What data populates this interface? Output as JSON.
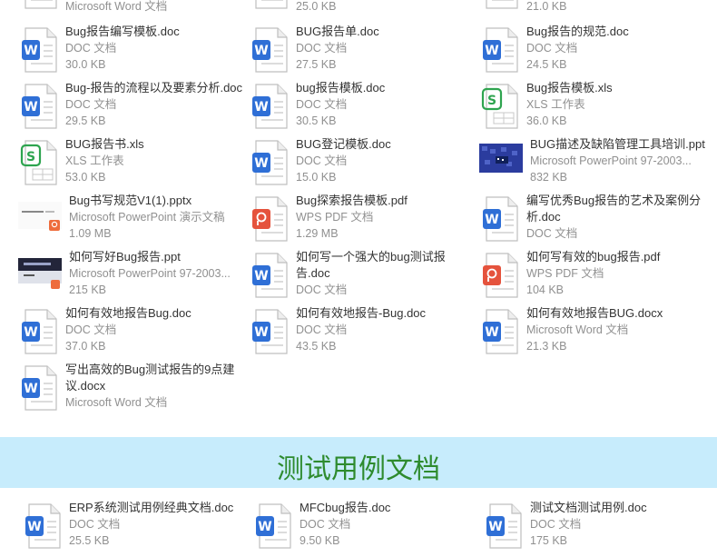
{
  "top_partial": {
    "c1_type": "Microsoft Word 文档",
    "c2_size": "25.0 KB",
    "c3_size": "21.0 KB"
  },
  "rows": [
    [
      {
        "name": "Bug报告编写模板.doc",
        "type": "DOC 文档",
        "size": "30.0 KB",
        "icon": "word"
      },
      {
        "name": "BUG报告单.doc",
        "type": "DOC 文档",
        "size": "27.5 KB",
        "icon": "word"
      },
      {
        "name": "Bug报告的规范.doc",
        "type": "DOC 文档",
        "size": "24.5 KB",
        "icon": "word"
      }
    ],
    [
      {
        "name": "Bug-报告的流程以及要素分析.doc",
        "type": "DOC 文档",
        "size": "29.5 KB",
        "icon": "word"
      },
      {
        "name": "bug报告模板.doc",
        "type": "DOC 文档",
        "size": "30.5 KB",
        "icon": "word"
      },
      {
        "name": "Bug报告模板.xls",
        "type": "XLS 工作表",
        "size": "36.0 KB",
        "icon": "excel"
      }
    ],
    [
      {
        "name": "BUG报告书.xls",
        "type": "XLS 工作表",
        "size": "53.0 KB",
        "icon": "excel"
      },
      {
        "name": "BUG登记模板.doc",
        "type": "DOC 文档",
        "size": "15.0 KB",
        "icon": "word"
      },
      {
        "name": "BUG描述及缺陷管理工具培训.ppt",
        "type": "Microsoft PowerPoint 97-2003...",
        "size": "832 KB",
        "icon": "ppt-thumb-blue"
      }
    ],
    [
      {
        "name": "Bug书写规范V1(1).pptx",
        "type": "Microsoft PowerPoint 演示文稿",
        "size": "1.09 MB",
        "icon": "pptx-thumb"
      },
      {
        "name": "Bug探索报告模板.pdf",
        "type": "WPS PDF 文档",
        "size": "1.29 MB",
        "icon": "pdf"
      },
      {
        "name": "编写优秀Bug报告的艺术及案例分析.doc",
        "type": "DOC 文档",
        "size": "",
        "icon": "word",
        "wrap": true
      }
    ],
    [
      {
        "name": "如何写好Bug报告.ppt",
        "type": "Microsoft PowerPoint 97-2003...",
        "size": "215 KB",
        "icon": "ppt-thumb-dark"
      },
      {
        "name": "如何写一个强大的bug测试报告.doc",
        "type": "DOC 文档",
        "size": "",
        "icon": "word",
        "wrap": true
      },
      {
        "name": "如何写有效的bug报告.pdf",
        "type": "WPS PDF 文档",
        "size": "104 KB",
        "icon": "pdf"
      }
    ],
    [
      {
        "name": "如何有效地报告Bug.doc",
        "type": "DOC 文档",
        "size": "37.0 KB",
        "icon": "word"
      },
      {
        "name": "如何有效地报告-Bug.doc",
        "type": "DOC 文档",
        "size": "43.5 KB",
        "icon": "word"
      },
      {
        "name": "如何有效地报告BUG.docx",
        "type": "Microsoft Word 文档",
        "size": "21.3 KB",
        "icon": "word-blue"
      }
    ],
    [
      {
        "name": "写出高效的Bug测试报告的9点建议.docx",
        "type": "Microsoft Word 文档",
        "size": "",
        "icon": "word-blue",
        "wrap": true
      }
    ]
  ],
  "banner": {
    "title": "测试用例文档"
  },
  "bottom_row": [
    {
      "name": "ERP系统测试用例经典文档.doc",
      "type": "DOC 文档",
      "size": "25.5 KB",
      "icon": "word"
    },
    {
      "name": "MFCbug报告.doc",
      "type": "DOC 文档",
      "size": "9.50 KB",
      "icon": "word"
    },
    {
      "name": "测试文档测试用例.doc",
      "type": "DOC 文档",
      "size": "175 KB",
      "icon": "word"
    }
  ],
  "colors": {
    "word": "#2f6fd6",
    "excel": "#2ea44f",
    "pdf": "#e5533d",
    "banner_bg": "#c7ecfc",
    "banner_text": "#2e8b2e"
  }
}
